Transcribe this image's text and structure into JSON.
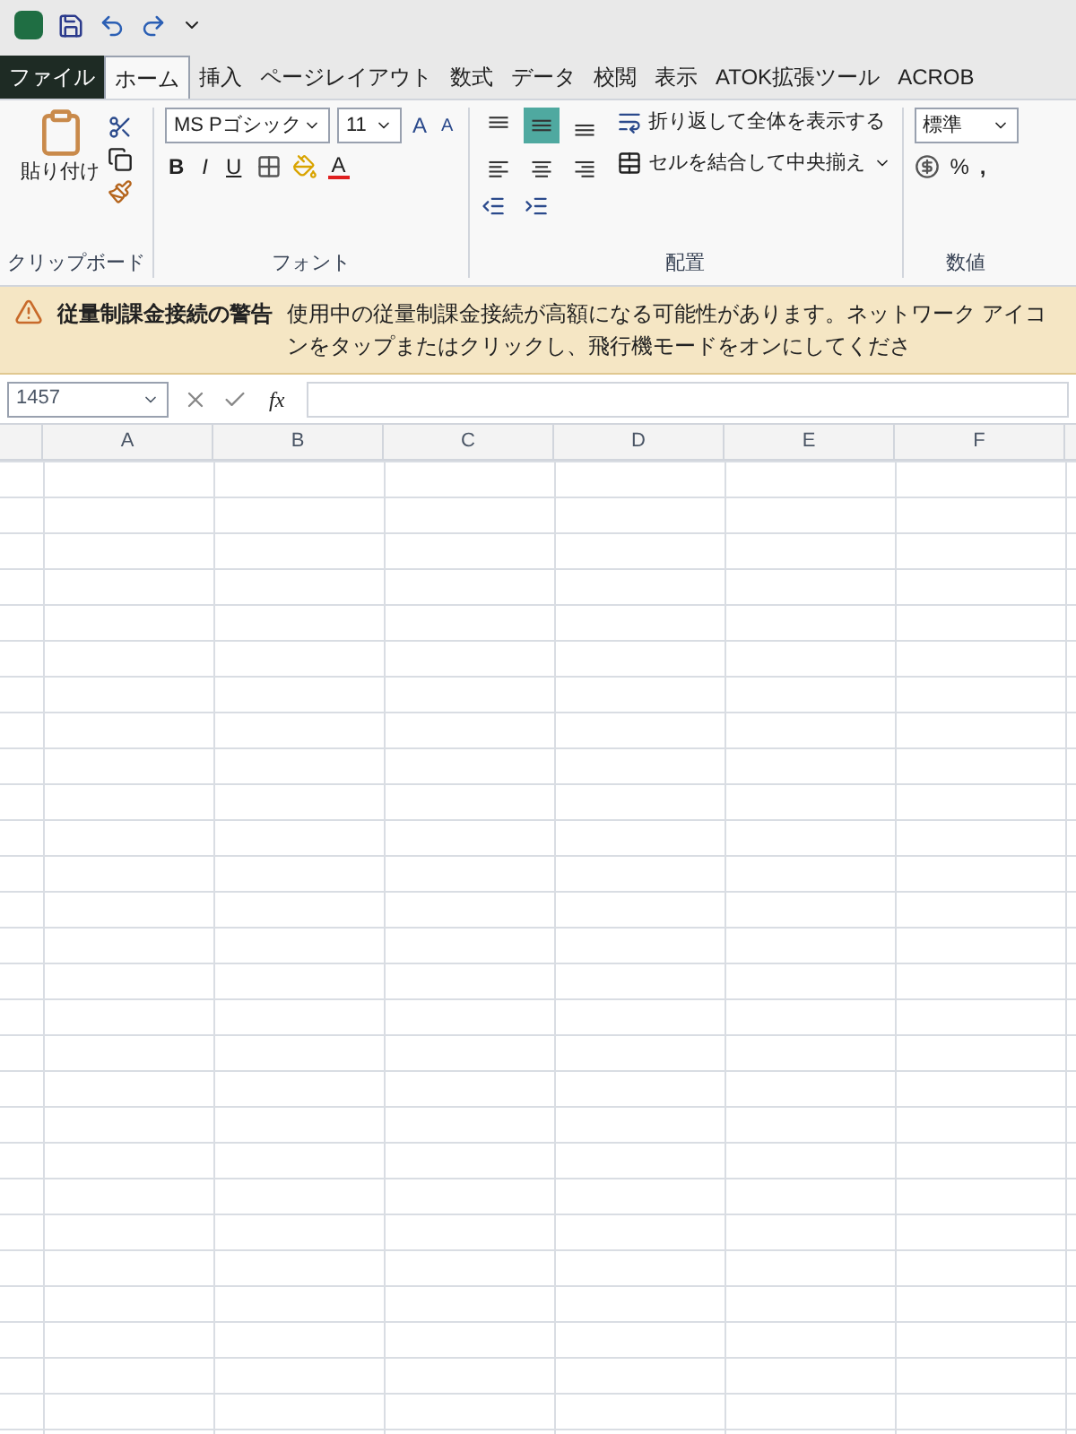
{
  "tabs": [
    {
      "label": "ファイル",
      "kind": "file",
      "selected": false
    },
    {
      "label": "ホーム",
      "kind": "tab",
      "selected": true
    },
    {
      "label": "挿入",
      "kind": "tab",
      "selected": false
    },
    {
      "label": "ページレイアウト",
      "kind": "tab",
      "selected": false
    },
    {
      "label": "数式",
      "kind": "tab",
      "selected": false
    },
    {
      "label": "データ",
      "kind": "tab",
      "selected": false
    },
    {
      "label": "校閲",
      "kind": "tab",
      "selected": false
    },
    {
      "label": "表示",
      "kind": "tab",
      "selected": false
    },
    {
      "label": "ATOK拡張ツール",
      "kind": "tab",
      "selected": false
    },
    {
      "label": "ACROB",
      "kind": "tab",
      "selected": false
    }
  ],
  "clipboard": {
    "paste_label": "貼り付け",
    "group_label": "クリップボード"
  },
  "font": {
    "font_name": "MS Pゴシック",
    "font_size": "11",
    "bold": "B",
    "italic": "I",
    "underline": "U",
    "grow": "A",
    "shrink": "A",
    "font_color": "A",
    "group_label": "フォント"
  },
  "alignment": {
    "align_buttons": [
      {
        "kind": "top",
        "selected": false
      },
      {
        "kind": "middle",
        "selected": true
      },
      {
        "kind": "bottom",
        "selected": false
      },
      {
        "kind": "left",
        "selected": false
      },
      {
        "kind": "center",
        "selected": false
      },
      {
        "kind": "right",
        "selected": false
      }
    ],
    "wrap_text": "折り返して全体を表示する",
    "merge_center": "セルを結合して中央揃え",
    "group_label": "配置"
  },
  "number": {
    "format": "標準",
    "percent": "%",
    "comma": ",",
    "group_label": "数値"
  },
  "warning": {
    "title": "従量制課金接続の警告",
    "message": "使用中の従量制課金接続が高額になる可能性があります。ネットワーク アイコンをタップまたはクリックし、飛行機モードをオンにしてくださ"
  },
  "formula_bar": {
    "name_box": "1457",
    "fx": "fx"
  },
  "columns": [
    "A",
    "B",
    "C",
    "D",
    "E",
    "F"
  ]
}
